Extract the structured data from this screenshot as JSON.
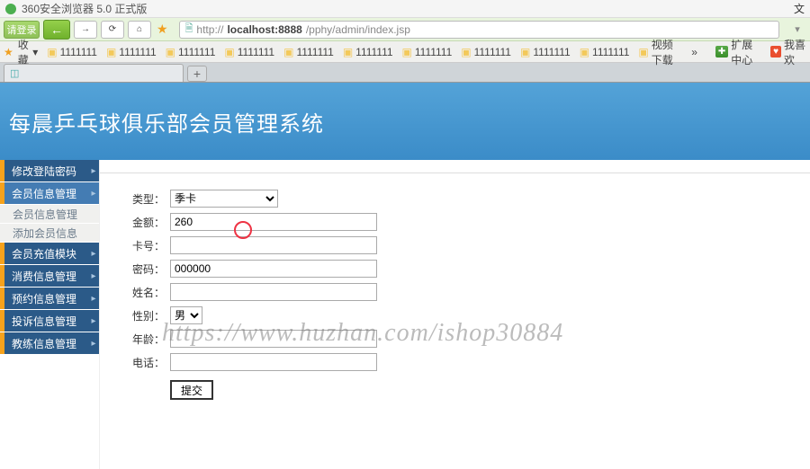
{
  "browser": {
    "title": "360安全浏览器 5.0 正式版",
    "login_label": "请登录",
    "back_glyph": "←",
    "fwd_glyph": "→",
    "reload_glyph": "⟳",
    "home_glyph": "⌂",
    "url_prefix": "http://",
    "url_host": "localhost:8888",
    "url_path": "/pphy/admin/index.jsp",
    "doc_glyph": "🗎",
    "right_fav": "★",
    "right_fav_label": "收藏",
    "right_arrow": "▾",
    "top_right": "文"
  },
  "bookmarks": {
    "fav_label": "收藏",
    "items": [
      "1111111",
      "1111111",
      "1111111",
      "1111111",
      "1111111",
      "1111111",
      "1111111",
      "1111111",
      "1111111",
      "1111111"
    ],
    "video": "视频下载",
    "more": "»",
    "ext_label": "扩展中心",
    "like_label": "我喜欢"
  },
  "tabs": {
    "plus": "+",
    "current": ""
  },
  "app": {
    "title": "每晨乒乓球俱乐部会员管理系统"
  },
  "sidebar": {
    "items": [
      {
        "label": "修改登陆密码",
        "type": "item"
      },
      {
        "label": "会员信息管理",
        "type": "item"
      },
      {
        "label": "会员信息管理",
        "type": "sub"
      },
      {
        "label": "添加会员信息",
        "type": "sub"
      },
      {
        "label": "会员充值模块",
        "type": "item"
      },
      {
        "label": "消费信息管理",
        "type": "item"
      },
      {
        "label": "预约信息管理",
        "type": "item"
      },
      {
        "label": "投诉信息管理",
        "type": "item"
      },
      {
        "label": "教练信息管理",
        "type": "item"
      }
    ]
  },
  "form": {
    "type_label": "类型：",
    "type_value": "季卡",
    "amount_label": "金额：",
    "amount_value": "260",
    "card_label": "卡号：",
    "card_value": "",
    "pwd_label": "密码：",
    "pwd_value": "000000",
    "name_label": "姓名：",
    "name_value": "",
    "sex_label": "性别：",
    "sex_value": "男",
    "age_label": "年龄：",
    "age_value": "",
    "tel_label": "电话：",
    "tel_value": "",
    "submit": "提交"
  },
  "watermark": "https://www.huzhan.com/ishop30884"
}
